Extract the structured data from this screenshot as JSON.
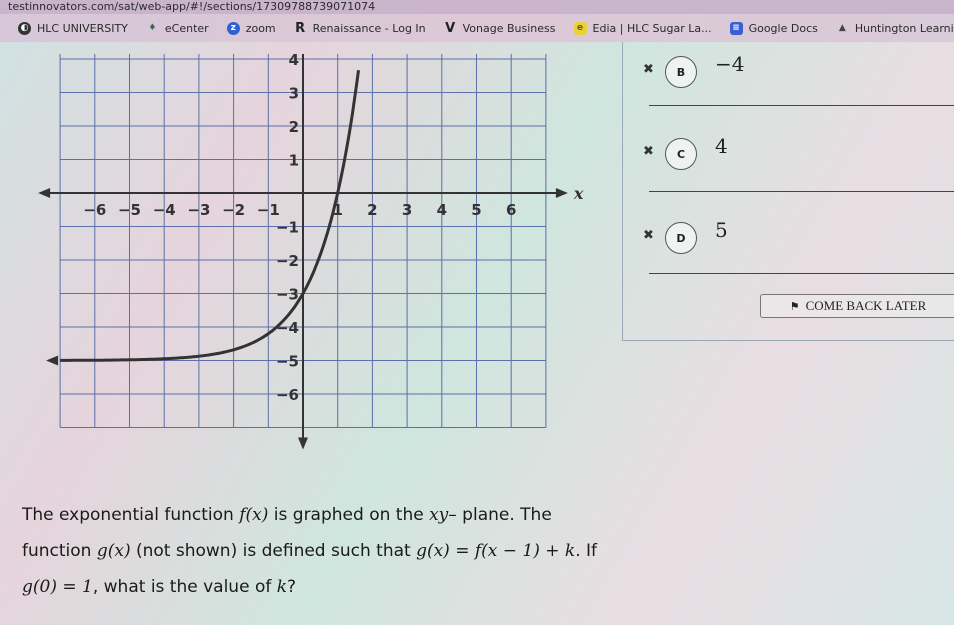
{
  "browser": {
    "url": "testinnovators.com/sat/web-app/#!/sections/17309788739071074",
    "bookmarks": [
      {
        "label": "HLC UNIVERSITY",
        "icon": "globe-icon"
      },
      {
        "label": "eCenter",
        "icon": "drop-icon"
      },
      {
        "label": "zoom",
        "icon": "zoom-icon"
      },
      {
        "label": "Renaissance - Log In",
        "icon": "renaissance-icon"
      },
      {
        "label": "Vonage Business",
        "icon": "vonage-icon"
      },
      {
        "label": "Edia | HLC Sugar La...",
        "icon": "edia-icon"
      },
      {
        "label": "Google Docs",
        "icon": "docs-icon"
      },
      {
        "label": "Huntington Learnin...",
        "icon": "huntington-icon"
      }
    ]
  },
  "answers": [
    {
      "letter": "B",
      "value": "−4"
    },
    {
      "letter": "C",
      "value": "4"
    },
    {
      "letter": "D",
      "value": "5"
    }
  ],
  "eliminate_glyph": "✖",
  "come_back_later": "COME BACK LATER",
  "question": {
    "p1": "The exponential function ",
    "f_x": "f(x)",
    "p2": " is graphed on the ",
    "xy": "xy",
    "p3": "– plane. The function ",
    "g_x": "g(x)",
    "p4": " (not shown) is defined such that ",
    "eq": "g(x) = f(x − 1) + k",
    "p5": ". If ",
    "g0": "g(0) = 1",
    "p6": ", what is the value of ",
    "k": "k",
    "p7": "?"
  },
  "chart_data": {
    "type": "line",
    "title": "",
    "xlabel": "x",
    "ylabel": "",
    "xlim": [
      -7,
      7
    ],
    "ylim": [
      -7,
      4
    ],
    "x_ticks": [
      -6,
      -5,
      -4,
      -3,
      -2,
      -1,
      1,
      2,
      3,
      4,
      5,
      6
    ],
    "y_ticks": [
      4,
      3,
      2,
      1,
      -1,
      -2,
      -3,
      -4,
      -5,
      -6
    ],
    "grid": true,
    "series": [
      {
        "name": "f(x)",
        "function": "-5 + 2*2.5^x",
        "points": [
          [
            -7,
            -5.0
          ],
          [
            -4,
            -4.95
          ],
          [
            -2,
            -4.68
          ],
          [
            -1,
            -4.2
          ],
          [
            0,
            -3
          ],
          [
            1,
            0
          ],
          [
            1.6,
            4.1
          ]
        ]
      }
    ],
    "asymptote": -5
  }
}
